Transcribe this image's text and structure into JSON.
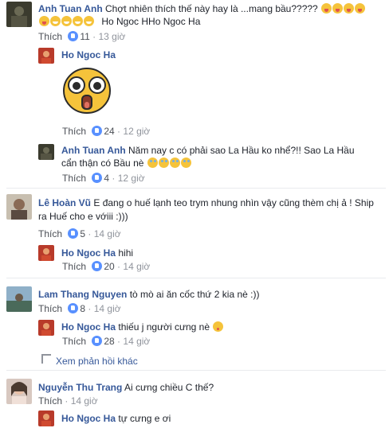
{
  "comments": [
    {
      "author": "Anh Tuan Anh",
      "text_line1": "Chợt nhiên thích thế này hay là ...mang bầu?????",
      "text_line2": "Ho Ngoc HHo Ngoc Ha",
      "like_label": "Thích",
      "likes": "11",
      "time": "13 giờ",
      "avatar_color": "#4a4a3a"
    },
    {
      "author": "Ho Ngoc Ha",
      "like_label": "Thích",
      "likes": "24",
      "time": "12 giờ",
      "avatar_color": "#c0392b",
      "sticker_name": "shocked-face-sticker"
    },
    {
      "author": "Anh Tuan Anh",
      "text_line1": "Năm nay c có phải sao La Hầu ko nhể?!! Sao La Hầu",
      "text_line2": "cẩn thận có Bầu nè",
      "like_label": "Thích",
      "likes": "4",
      "time": "12 giờ",
      "avatar_color": "#4a4a3a"
    },
    {
      "author": "Lê Hoàn Vũ",
      "text_line1": "E đang o huế lạnh teo trym nhung nhìn vậy cũng thèm chị ả ! Ship",
      "text_line2": "ra Huế cho e vớiii :)))",
      "like_label": "Thích",
      "likes": "5",
      "time": "14 giờ",
      "avatar_color": "#9a8a7a"
    },
    {
      "author": "Ho Ngoc Ha",
      "text_line1": "hihi",
      "like_label": "Thích",
      "likes": "20",
      "time": "14 giờ",
      "avatar_color": "#c0392b"
    },
    {
      "author": "Lam Thang Nguyen",
      "text_line1": "tò mò ai ăn cốc thứ 2 kia nè :))",
      "like_label": "Thích",
      "likes": "8",
      "time": "14 giờ",
      "avatar_color": "#6f8fa8"
    },
    {
      "author": "Ho Ngoc Ha",
      "text_line1": "thiếu j người cưng nè",
      "like_label": "Thích",
      "likes": "28",
      "time": "14 giờ",
      "avatar_color": "#c0392b"
    },
    {
      "author": "Nguyễn Thu Trang",
      "text_line1": "Ai cưng chiều C thế?",
      "like_label": "Thích",
      "likes": "",
      "time": "14 giờ",
      "avatar_color": "#b89a8a"
    },
    {
      "author": "Ho Ngoc Ha",
      "text_line1": "tự cưng e ơi",
      "avatar_color": "#c0392b"
    }
  ],
  "more_replies_label": "Xem phản hồi khác",
  "colors": {
    "link": "#365899",
    "meta": "#90949c",
    "like_badge": "#5890ff",
    "divider": "#e9ebee"
  }
}
